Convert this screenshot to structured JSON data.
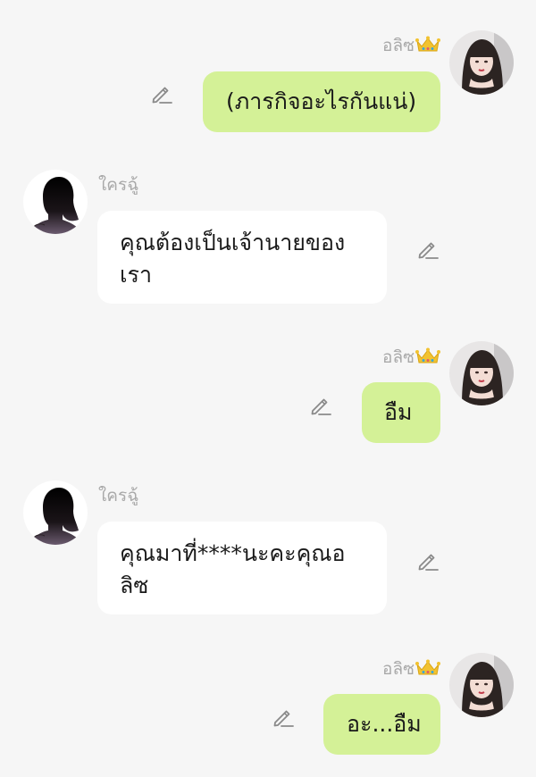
{
  "messages": [
    {
      "side": "out",
      "sender": "อลิซ",
      "text": "(ภารกิจอะไรกันแน่)"
    },
    {
      "side": "in",
      "sender": "ใครฉู้",
      "text": "คุณต้องเป็นเจ้านายของเรา"
    },
    {
      "side": "out",
      "sender": "อลิซ",
      "text": "อืม"
    },
    {
      "side": "in",
      "sender": "ใครฉู้",
      "text": "คุณมาที่****นะคะคุณอลิซ"
    },
    {
      "side": "out",
      "sender": "อลิซ",
      "text": "อะ...อืม"
    }
  ],
  "colors": {
    "background": "#f6f6f6",
    "outgoing_bubble": "#d4f197",
    "incoming_bubble": "#ffffff",
    "name_text": "#a9a9a9",
    "crown": "#f2c230"
  },
  "icons": {
    "edit": "pencil-edit-icon",
    "crown": "crown-icon"
  }
}
